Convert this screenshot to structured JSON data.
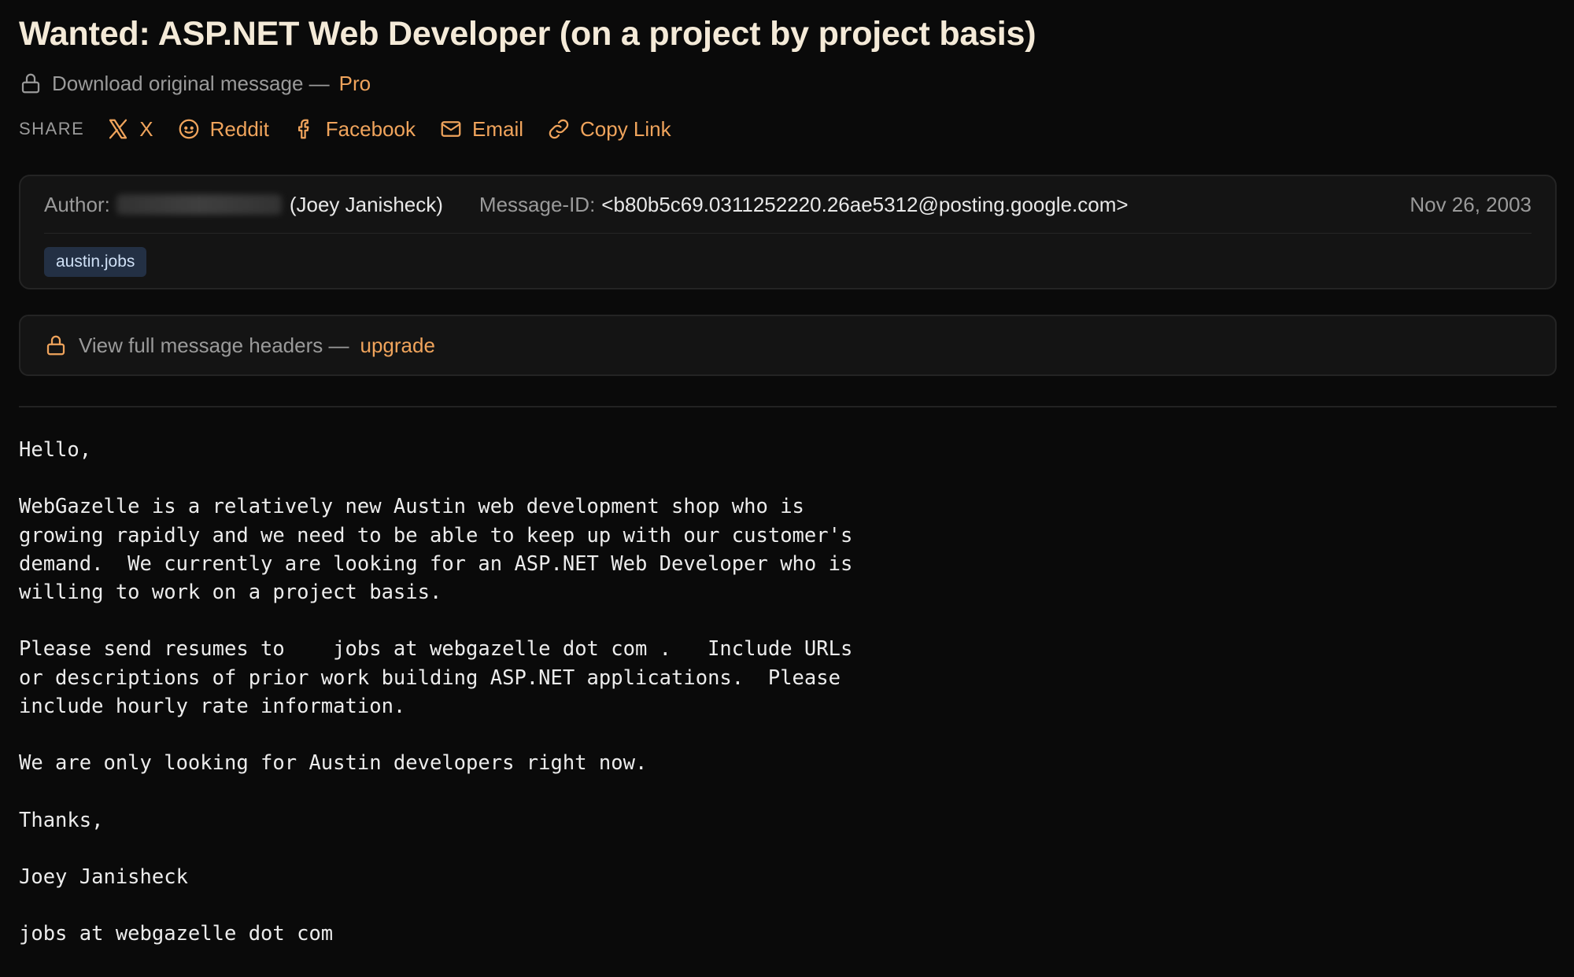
{
  "title": "Wanted: ASP.NET Web Developer (on a project by project basis)",
  "download": {
    "text": "Download original message —",
    "pro_label": "Pro",
    "icon": "lock-icon"
  },
  "share": {
    "label": "SHARE",
    "links": [
      {
        "label": "X",
        "icon": "x-logo-icon"
      },
      {
        "label": "Reddit",
        "icon": "reddit-icon"
      },
      {
        "label": "Facebook",
        "icon": "facebook-icon"
      },
      {
        "label": "Email",
        "icon": "mail-icon"
      },
      {
        "label": "Copy Link",
        "icon": "link-icon"
      }
    ]
  },
  "meta": {
    "author_label": "Author:",
    "author_name": "(Joey Janisheck)",
    "message_id_label": "Message-ID:",
    "message_id": "<b80b5c69.0311252220.26ae5312@posting.google.com>",
    "date": "Nov 26, 2003",
    "tag": "austin.jobs"
  },
  "headers": {
    "text": "View full message headers —",
    "upgrade_label": "upgrade",
    "icon": "lock-icon"
  },
  "body": "Hello,\n\nWebGazelle is a relatively new Austin web development shop who is\ngrowing rapidly and we need to be able to keep up with our customer's\ndemand.  We currently are looking for an ASP.NET Web Developer who is\nwilling to work on a project basis.\n\nPlease send resumes to    jobs at webgazelle dot com .   Include URLs\nor descriptions of prior work building ASP.NET applications.  Please\ninclude hourly rate information.\n\nWe are only looking for Austin developers right now.\n\nThanks,\n\nJoey Janisheck\n\njobs at webgazelle dot com",
  "colors": {
    "accent": "#f0a45c",
    "background": "#0a0a0a",
    "tag_bg": "#233044"
  }
}
